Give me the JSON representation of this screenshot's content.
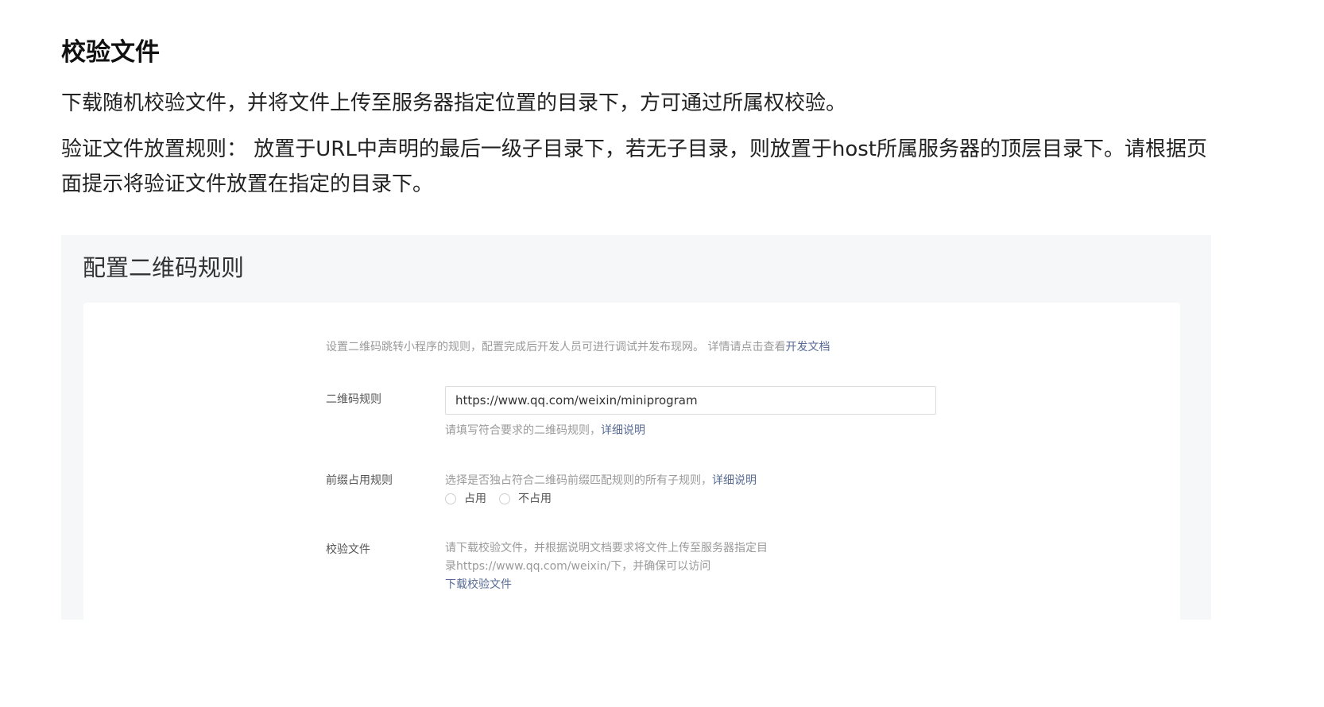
{
  "doc": {
    "heading": "校验文件",
    "paragraph_1": "下载随机校验文件，并将文件上传至服务器指定位置的目录下，方可通过所属权校验。",
    "paragraph_2": "验证文件放置规则： 放置于URL中声明的最后一级子目录下，若无子目录，则放置于host所属服务器的顶层目录下。请根据页面提示将验证文件放置在指定的目录下。"
  },
  "panel": {
    "title": "配置二维码规则",
    "intro_text": "设置二维码跳转小程序的规则，配置完成后开发人员可进行调试并发布现网。 详情请点击查看",
    "intro_link": "开发文档",
    "qr_rule": {
      "label": "二维码规则",
      "value": "https://www.qq.com/weixin/miniprogram",
      "hint": "请填写符合要求的二维码规则，",
      "hint_link": "详细说明"
    },
    "prefix_rule": {
      "label": "前缀占用规则",
      "hint": "选择是否独占符合二维码前缀匹配规则的所有子规则，",
      "hint_link": "详细说明",
      "options": [
        "占用",
        "不占用"
      ]
    },
    "verify_file": {
      "label": "校验文件",
      "hint_line_1": "请下载校验文件，并根据说明文档要求将文件上传至服务器指定目",
      "hint_line_2": "录https://www.qq.com/weixin/下，并确保可以访问",
      "download_link": "下载校验文件"
    }
  },
  "colors": {
    "link": "#576b95",
    "panel_bg": "#f6f7f9",
    "hint_text": "#9a9a9a"
  }
}
